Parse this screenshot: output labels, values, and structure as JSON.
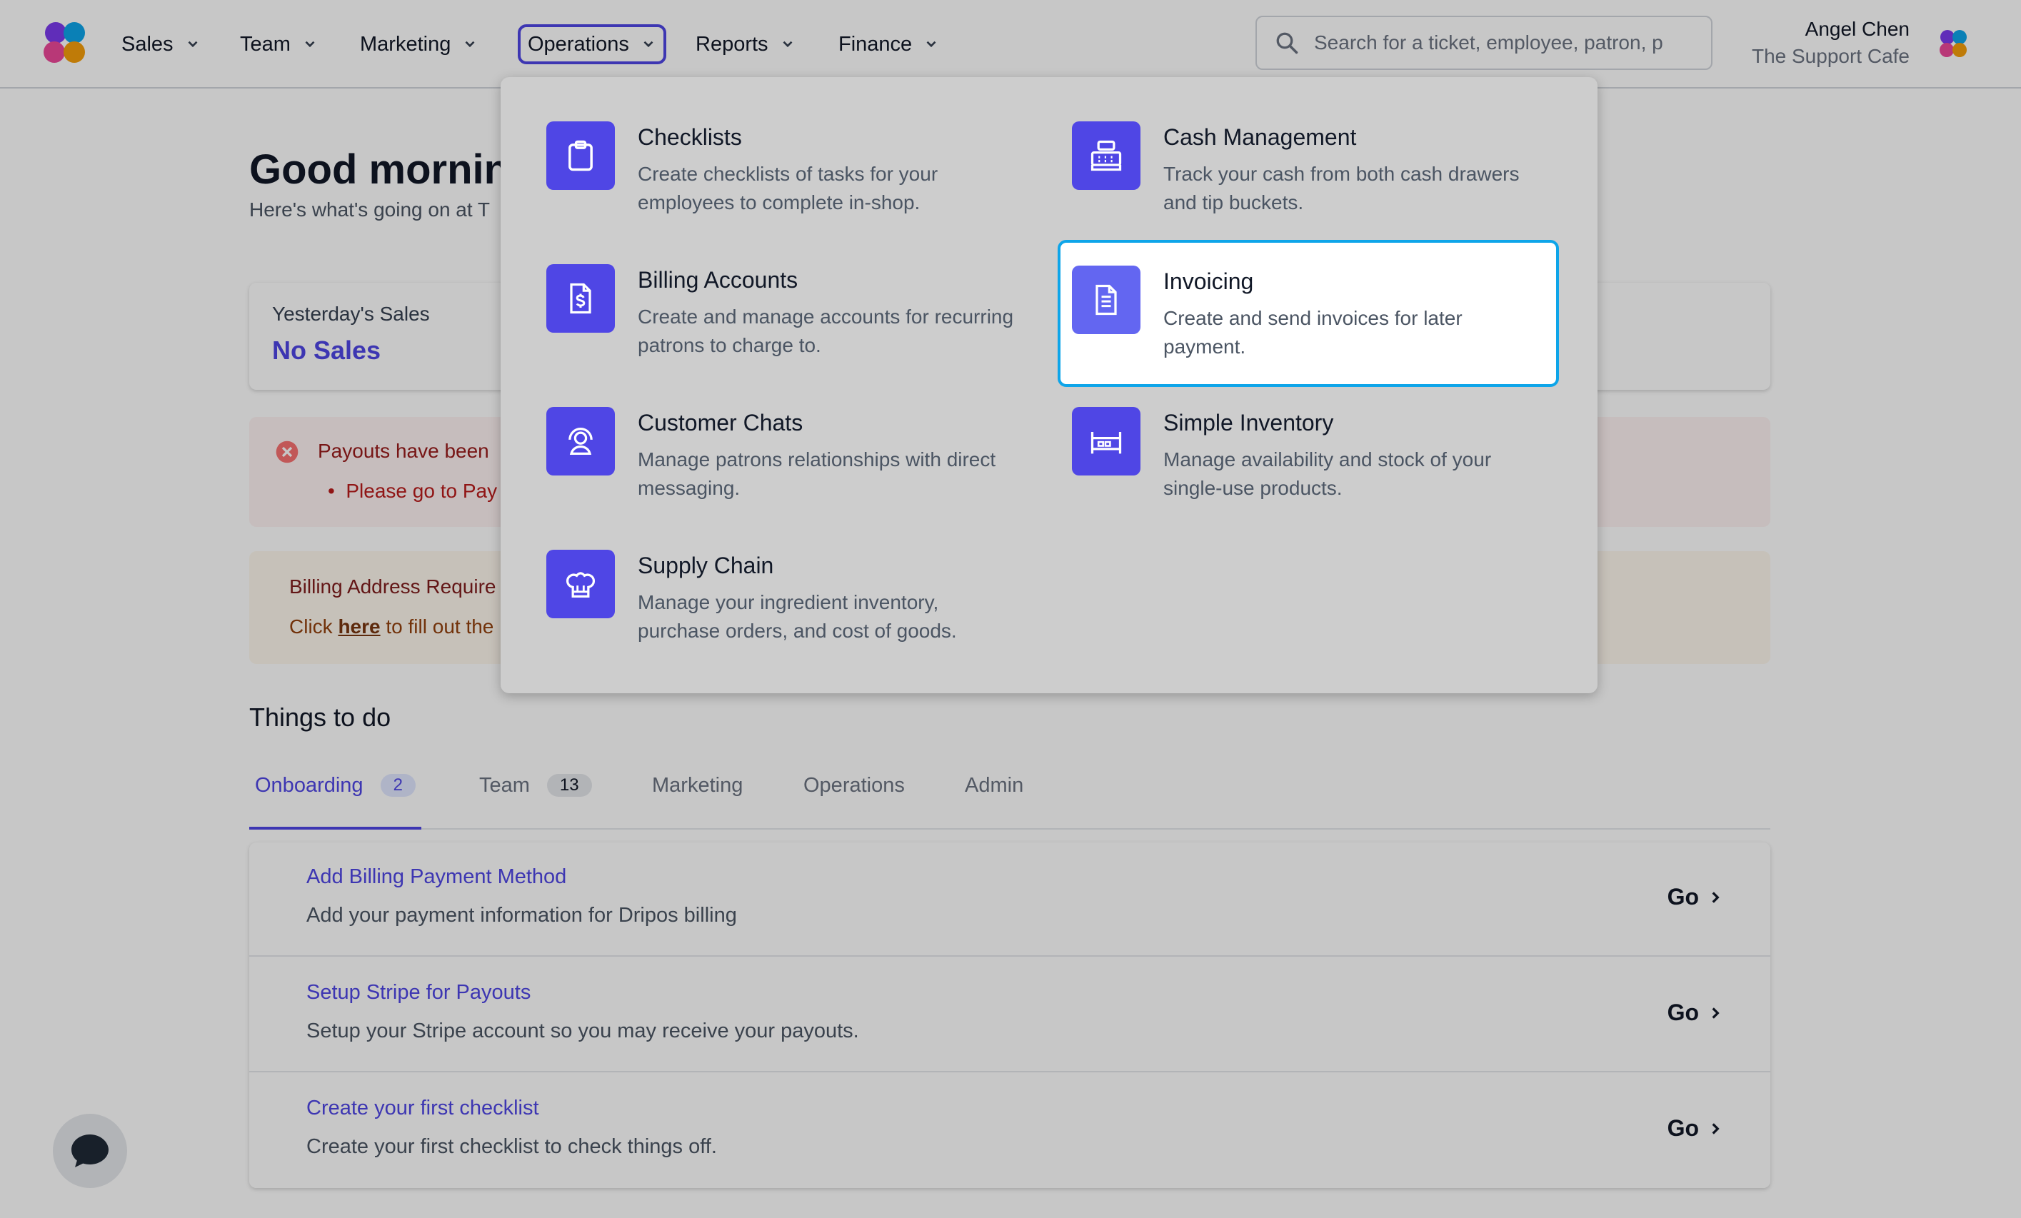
{
  "nav": {
    "items": [
      {
        "label": "Sales"
      },
      {
        "label": "Team"
      },
      {
        "label": "Marketing"
      },
      {
        "label": "Operations"
      },
      {
        "label": "Reports"
      },
      {
        "label": "Finance"
      }
    ],
    "active_item": "Operations",
    "search_placeholder": "Search for a ticket, employee, patron, p",
    "user_name": "Angel Chen",
    "org_name": "The Support Cafe"
  },
  "page": {
    "greeting": "Good mornin",
    "subgreeting": "Here's what's going on at T",
    "sales_label": "Yesterday's Sales",
    "sales_value": "No Sales",
    "payout_alert": "Payouts have been",
    "payout_bullet": "Please go to Pay",
    "billing_title": "Billing Address Require",
    "billing_text_pre": "Click ",
    "billing_link": "here",
    "billing_text_post": " to fill out the",
    "todo_section_title": "Things to do"
  },
  "tabs": [
    {
      "label": "Onboarding",
      "count": "2"
    },
    {
      "label": "Team",
      "count": "13"
    },
    {
      "label": "Marketing"
    },
    {
      "label": "Operations"
    },
    {
      "label": "Admin"
    }
  ],
  "todos": [
    {
      "title": "Add Billing Payment Method",
      "desc": "Add your payment information for Dripos billing",
      "action": "Go"
    },
    {
      "title": "Setup Stripe for Payouts",
      "desc": "Setup your Stripe account so you may receive your payouts.",
      "action": "Go"
    },
    {
      "title": "Create your first checklist",
      "desc": "Create your first checklist to check things off.",
      "action": "Go"
    }
  ],
  "dropdown": {
    "items": [
      {
        "title": "Checklists",
        "desc": "Create checklists of tasks for your employees to complete in-shop.",
        "icon": "clipboard-icon"
      },
      {
        "title": "Cash Management",
        "desc": "Track your cash from both cash drawers and tip buckets.",
        "icon": "cash-register-icon"
      },
      {
        "title": "Billing Accounts",
        "desc": "Create and manage accounts for recurring patrons to charge to.",
        "icon": "dollar-document-icon"
      },
      {
        "title": "Invoicing",
        "desc": "Create and send invoices for later payment.",
        "icon": "invoice-icon"
      },
      {
        "title": "Customer Chats",
        "desc": "Manage patrons relationships with direct messaging.",
        "icon": "headset-icon"
      },
      {
        "title": "Simple Inventory",
        "desc": "Manage availability and stock of your single-use products.",
        "icon": "shelf-icon"
      },
      {
        "title": "Supply Chain",
        "desc": "Manage your ingredient inventory, purchase orders, and cost of goods.",
        "icon": "chef-hat-icon"
      }
    ],
    "highlighted": "Invoicing"
  },
  "colors": {
    "accent": "#4f46e5",
    "highlight_border": "#0ea5e9",
    "error": "#dc2626",
    "warning_text": "#92400e"
  }
}
